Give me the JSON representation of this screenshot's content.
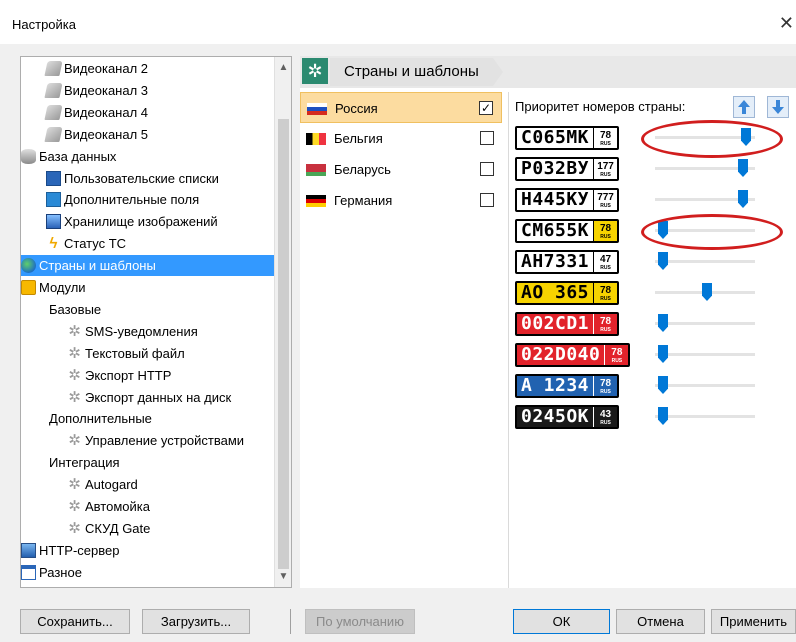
{
  "window": {
    "title": "Настройка",
    "close_icon": "close-icon"
  },
  "tree": {
    "items": [
      {
        "label": "Видеоканал 2",
        "icon": "camera-icon",
        "indent": 1
      },
      {
        "label": "Видеоканал 3",
        "icon": "camera-icon",
        "indent": 1
      },
      {
        "label": "Видеоканал 4",
        "icon": "camera-icon",
        "indent": 1
      },
      {
        "label": "Видеоканал 5",
        "icon": "camera-icon",
        "indent": 1
      },
      {
        "label": "База данных",
        "icon": "database-icon",
        "indent": 0
      },
      {
        "label": "Пользовательские списки",
        "icon": "list-icon",
        "indent": 1
      },
      {
        "label": "Дополнительные поля",
        "icon": "fields-icon",
        "indent": 1
      },
      {
        "label": "Хранилище изображений",
        "icon": "storage-icon",
        "indent": 1
      },
      {
        "label": "Статус ТС",
        "icon": "bolt-icon",
        "indent": 1
      },
      {
        "label": "Страны и шаблоны",
        "icon": "globe-icon",
        "indent": 0,
        "selected": true
      },
      {
        "label": "Модули",
        "icon": "puzzle-icon",
        "indent": 0
      },
      {
        "label": "Базовые",
        "icon": "",
        "indent": 1
      },
      {
        "label": "SMS-уведомления",
        "icon": "gear-icon",
        "indent": 2
      },
      {
        "label": "Текстовый файл",
        "icon": "gear-icon",
        "indent": 2
      },
      {
        "label": "Экспорт HTTP",
        "icon": "gear-icon",
        "indent": 2
      },
      {
        "label": "Экспорт данных на диск",
        "icon": "gear-icon",
        "indent": 2
      },
      {
        "label": "Дополнительные",
        "icon": "",
        "indent": 1
      },
      {
        "label": "Управление устройствами",
        "icon": "gear-icon",
        "indent": 2
      },
      {
        "label": "Интеграция",
        "icon": "",
        "indent": 1
      },
      {
        "label": "Autogard",
        "icon": "gear-icon",
        "indent": 2
      },
      {
        "label": "Автомойка",
        "icon": "gear-icon",
        "indent": 2
      },
      {
        "label": "СКУД Gate",
        "icon": "gear-icon",
        "indent": 2
      },
      {
        "label": "HTTP-сервер",
        "icon": "monitor-icon",
        "indent": 0
      },
      {
        "label": "Разное",
        "icon": "window-icon",
        "indent": 0
      }
    ],
    "scroll_up": "▲",
    "scroll_down": "▼"
  },
  "panel": {
    "title": "Страны и шаблоны",
    "countries": [
      {
        "name": "Россия",
        "checked": true,
        "selected": true,
        "flag": [
          "#ffffff",
          "#1c4fc0",
          "#d52b1e"
        ]
      },
      {
        "name": "Бельгия",
        "checked": false,
        "selected": false,
        "flag": [
          "#000000",
          "#fdda24",
          "#ef3340"
        ]
      },
      {
        "name": "Беларусь",
        "checked": false,
        "selected": false,
        "flag": [
          "#c8313e",
          "#c8313e",
          "#4aa657"
        ]
      },
      {
        "name": "Германия",
        "checked": false,
        "selected": false,
        "flag": [
          "#000000",
          "#dd0000",
          "#ffce00"
        ]
      }
    ],
    "check_mark": "✓",
    "priority_label": "Приоритет номеров страны:",
    "up_icon": "arrow-up-icon",
    "down_icon": "arrow-down-icon",
    "plates": [
      {
        "number": "С065МК",
        "region": "78",
        "bg": "#ffffff",
        "fg": "#000000",
        "reg_bg": "#ffffff",
        "reg_fg": "#000000",
        "priority": 0.95,
        "highlighted": true
      },
      {
        "number": "Р032ВУ",
        "region": "177",
        "bg": "#ffffff",
        "fg": "#000000",
        "reg_bg": "#ffffff",
        "reg_fg": "#000000",
        "priority": 0.92,
        "highlighted": false
      },
      {
        "number": "Н445КУ",
        "region": "777",
        "bg": "#ffffff",
        "fg": "#000000",
        "reg_bg": "#ffffff",
        "reg_fg": "#000000",
        "priority": 0.92,
        "highlighted": false
      },
      {
        "number": "СМ655К",
        "region": "78",
        "bg": "#ffffff",
        "fg": "#000000",
        "reg_bg": "#f6d300",
        "reg_fg": "#000000",
        "priority": 0.03,
        "highlighted": true
      },
      {
        "number": "АН7331",
        "region": "47",
        "bg": "#ffffff",
        "fg": "#000000",
        "reg_bg": "#ffffff",
        "reg_fg": "#000000",
        "priority": 0.03,
        "highlighted": false
      },
      {
        "number": "АО 365",
        "region": "78",
        "bg": "#f6d300",
        "fg": "#000000",
        "reg_bg": "#f6d300",
        "reg_fg": "#000000",
        "priority": 0.52,
        "highlighted": false
      },
      {
        "number": "002CD1",
        "region": "78",
        "bg": "#e2232b",
        "fg": "#ffffff",
        "reg_bg": "#e2232b",
        "reg_fg": "#ffffff",
        "priority": 0.03,
        "highlighted": false
      },
      {
        "number": "022D040",
        "region": "78",
        "bg": "#e2232b",
        "fg": "#ffffff",
        "reg_bg": "#e2232b",
        "reg_fg": "#ffffff",
        "priority": 0.03,
        "highlighted": false
      },
      {
        "number": "А 1234",
        "region": "78",
        "bg": "#2162b0",
        "fg": "#ffffff",
        "reg_bg": "#2162b0",
        "reg_fg": "#ffffff",
        "priority": 0.03,
        "highlighted": false
      },
      {
        "number": "0245ОК",
        "region": "43",
        "bg": "#1a1a1a",
        "fg": "#ffffff",
        "reg_bg": "#1a1a1a",
        "reg_fg": "#ffffff",
        "priority": 0.03,
        "highlighted": false
      }
    ],
    "region_sub": "RUS",
    "accent": "#0078d7",
    "annotation_color": "#d11e1e"
  },
  "buttons": {
    "save": "Сохранить...",
    "load": "Загрузить...",
    "default": "По умолчанию",
    "ok": "ОК",
    "cancel": "Отмена",
    "apply": "Применить"
  }
}
